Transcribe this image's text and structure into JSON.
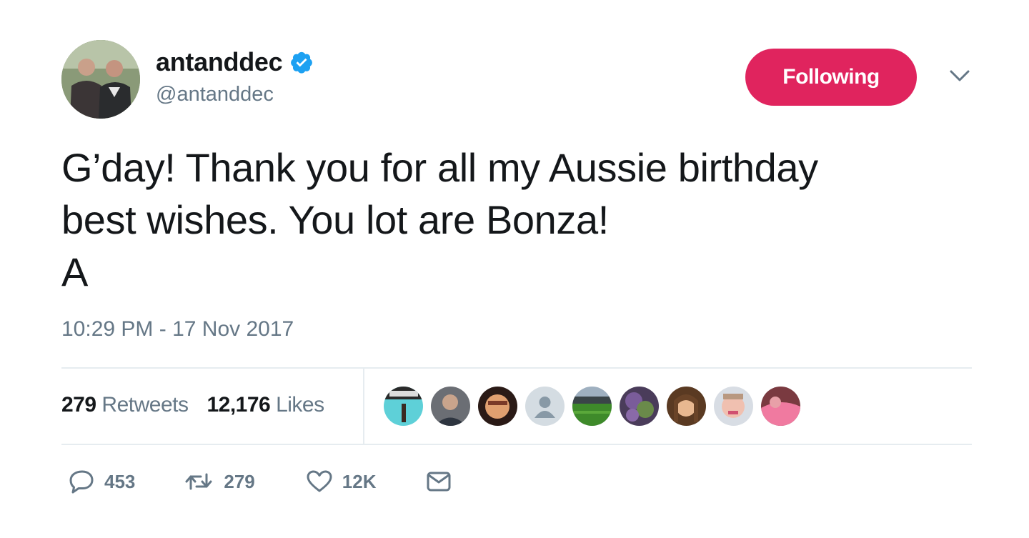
{
  "user": {
    "display_name": "antanddec",
    "handle": "@antanddec",
    "verified": true
  },
  "follow_button": {
    "label": "Following"
  },
  "tweet": {
    "text": "G’day! Thank you for all my Aussie birthday\nbest wishes. You lot are Bonza!\nA",
    "timestamp": "10:29 PM - 17 Nov 2017"
  },
  "stats": {
    "retweets_count": "279",
    "retweets_label": "Retweets",
    "likes_count": "12,176",
    "likes_label": "Likes"
  },
  "actions": {
    "replies": "453",
    "retweets": "279",
    "likes": "12K"
  },
  "colors": {
    "following_bg": "#e0245e",
    "verified": "#1da1f2",
    "secondary_text": "#657786",
    "divider": "#e6ecf0"
  }
}
